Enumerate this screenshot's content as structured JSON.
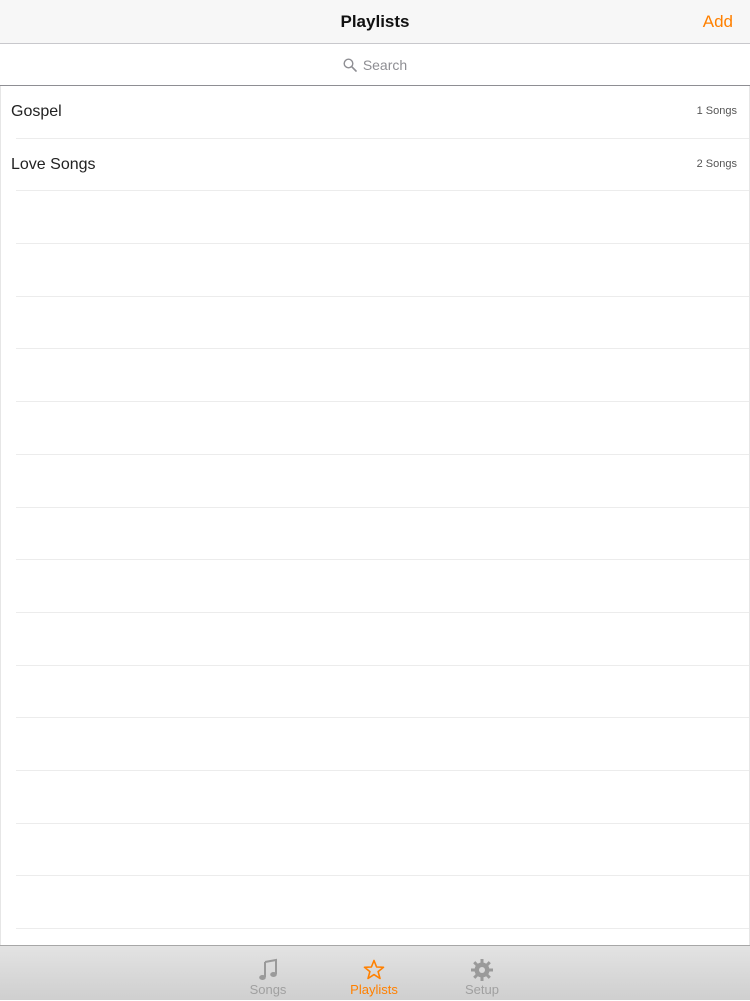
{
  "nav": {
    "title": "Playlists",
    "add_label": "Add"
  },
  "search": {
    "placeholder": "Search"
  },
  "playlists": [
    {
      "name": "Gospel",
      "count": "1 Songs"
    },
    {
      "name": "Love Songs",
      "count": "2 Songs"
    }
  ],
  "tabs": [
    {
      "label": "Songs",
      "icon": "music-note-icon",
      "active": false
    },
    {
      "label": "Playlists",
      "icon": "star-icon",
      "active": true
    },
    {
      "label": "Setup",
      "icon": "gear-icon",
      "active": false
    }
  ],
  "colors": {
    "accent": "#ff8000",
    "inactive_tab": "#a0a0a0"
  }
}
